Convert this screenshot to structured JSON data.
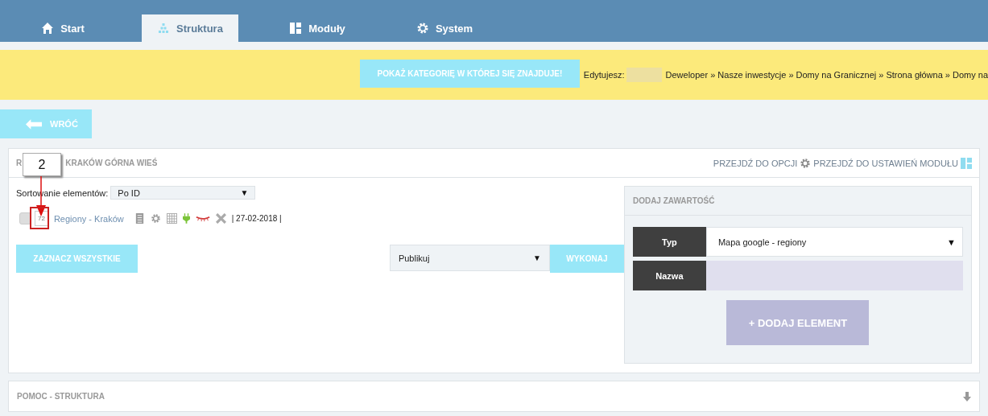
{
  "tabs": [
    {
      "label": "Start",
      "selected": false
    },
    {
      "label": "Struktura",
      "selected": true
    },
    {
      "label": "Moduły",
      "selected": false
    },
    {
      "label": "System",
      "selected": false
    }
  ],
  "caret": "▼",
  "notice": {
    "button": "POKAŻ KATEGORIĘ W KTÓREJ SIĘ ZNAJDUJE!",
    "editing_label": "Edytujesz:",
    "breadcrumb": "Deweloper » Nasze inwestycje » Domy na Granicznej » Strona główna » Domy na"
  },
  "back_button": "WRÓĆ",
  "panel": {
    "title_parts": [
      "R",
      "KRAKÓW GÓRNA WIEŚ"
    ],
    "links": [
      "PRZEJDŹ DO OPCJI",
      "PRZEJDŹ DO USTAWIEŃ MODUŁU"
    ],
    "sort_label": "Sortowanie elementów:",
    "sort_value": "Po ID",
    "items": [
      {
        "checked": false,
        "id": "72",
        "name": "Regiony - Kraków",
        "date": "| 27-02-2018 |"
      }
    ],
    "select_all": "ZAZNACZ WSZYSTKIE",
    "action_value": "Publikuj",
    "execute": "WYKONAJ",
    "callout": "2"
  },
  "add_panel": {
    "title": "DODAJ ZAWARTOŚĆ",
    "type_label": "Typ",
    "type_value": "Mapa google - regiony",
    "name_label": "Nazwa",
    "add_button": "+ DODAJ ELEMENT"
  },
  "help_panel": {
    "title": "POMOC - STRUKTURA"
  }
}
